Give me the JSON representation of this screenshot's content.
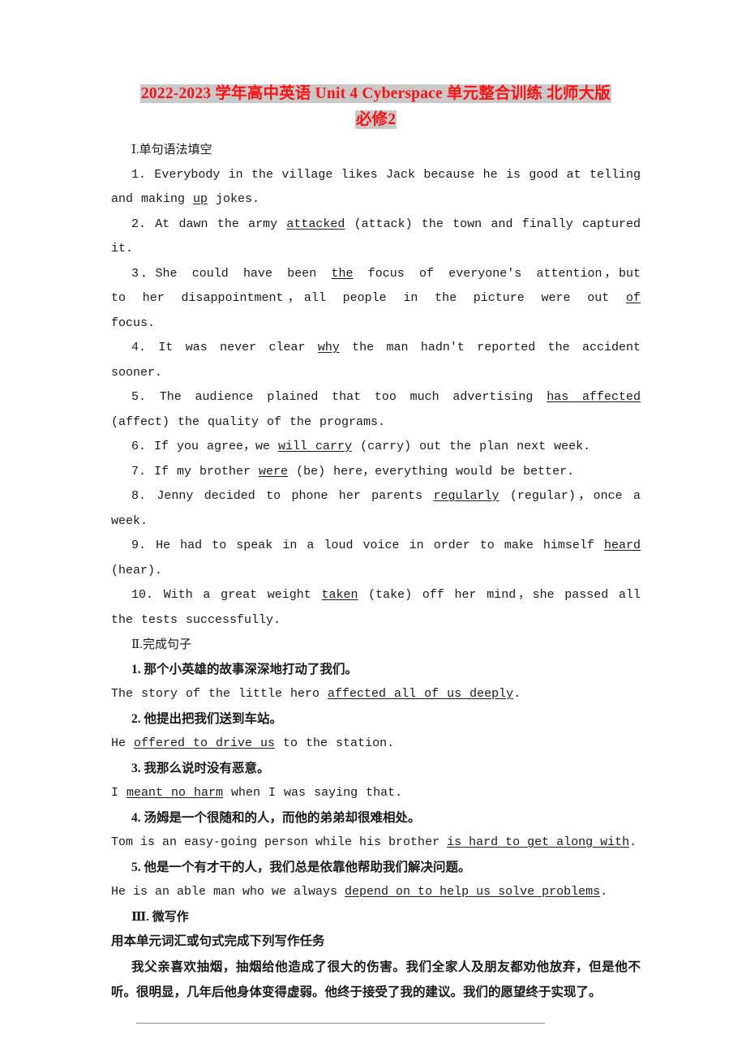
{
  "document": {
    "title": {
      "line1": "2022-2023 学年高中英语 Unit 4 Cyberspace 单元整合训练 北师大版",
      "line2": "必修2",
      "color": "#ff1111",
      "highlight": "#c9c9c9"
    },
    "section1": {
      "heading": "Ⅰ.单句语法填空",
      "items": [
        {
          "number": "1.",
          "before": " Everybody in the village likes Jack because he is good at telling and making ",
          "answer": "up",
          "after": " jokes."
        },
        {
          "number": "2.",
          "before": " At dawn the army ",
          "answer": "attacked",
          "after": " (attack) the town and finally captured it."
        },
        {
          "number": "3．",
          "before": "She could have been ",
          "answer": "the",
          "after": " focus of everyone's attention，but to her disappointment，all people in the picture were out ",
          "answer2": "of",
          "after2": " focus."
        },
        {
          "number": "4.",
          "before": " It was never clear ",
          "answer": "why",
          "after": " the man hadn't reported the accident sooner."
        },
        {
          "number": "5.",
          "before": " The audience plained that too much advertising ",
          "answer": "has affected",
          "after": " (affect) the quality of the programs."
        },
        {
          "number": "6.",
          "before": " If you agree，we ",
          "answer": "will carry",
          "after": " (carry) out the plan next week."
        },
        {
          "number": "7.",
          "before": " If my brother ",
          "answer": "were",
          "after": " (be) here，everything would be better."
        },
        {
          "number": "8.",
          "before": " Jenny decided to phone her parents ",
          "answer": "regularly",
          "after": " (regular)，once a week."
        },
        {
          "number": "9.",
          "before": " He had to speak in a loud voice in order to make himself ",
          "answer": "heard",
          "after": " (hear)."
        },
        {
          "number": "10.",
          "before": " With a great weight ",
          "answer": "taken",
          "after": " (take) off her mind，she passed all the tests successfully."
        }
      ]
    },
    "section2": {
      "heading": "Ⅱ.完成句子",
      "items": [
        {
          "number": "1.",
          "chinese": " 那个小英雄的故事深深地打动了我们。",
          "before": "The story of the little hero ",
          "answer": "affected all of us deeply",
          "after": "."
        },
        {
          "number": "2.",
          "chinese": " 他提出把我们送到车站。",
          "before": "He ",
          "answer": "offered to drive us",
          "after": " to the station."
        },
        {
          "number": "3.",
          "chinese": " 我那么说时没有恶意。",
          "before": "I ",
          "answer": "meant no harm",
          "after": " when I was saying that."
        },
        {
          "number": "4.",
          "chinese": " 汤姆是一个很随和的人，而他的弟弟却很难相处。",
          "before": "Tom is an easy-going person while his brother ",
          "answer": "is hard to get along with",
          "after": "."
        },
        {
          "number": "5.",
          "chinese": " 他是一个有才干的人，我们总是依靠他帮助我们解决问题。",
          "before": "He is an able man who we always ",
          "answer": "depend on to help us solve problems",
          "after": "."
        }
      ]
    },
    "section3": {
      "heading": "Ⅲ. 微写作",
      "instruction": "用本单元词汇或句式完成下列写作任务",
      "prompt": "我父亲喜欢抽烟，抽烟给他造成了很大的伤害。我们全家人及朋友都劝他放弃，但是他不听。很明显，几年后他身体变得虚弱。他终于接受了我的建议。我们的愿望终于实现了。",
      "answer_line": ""
    }
  }
}
